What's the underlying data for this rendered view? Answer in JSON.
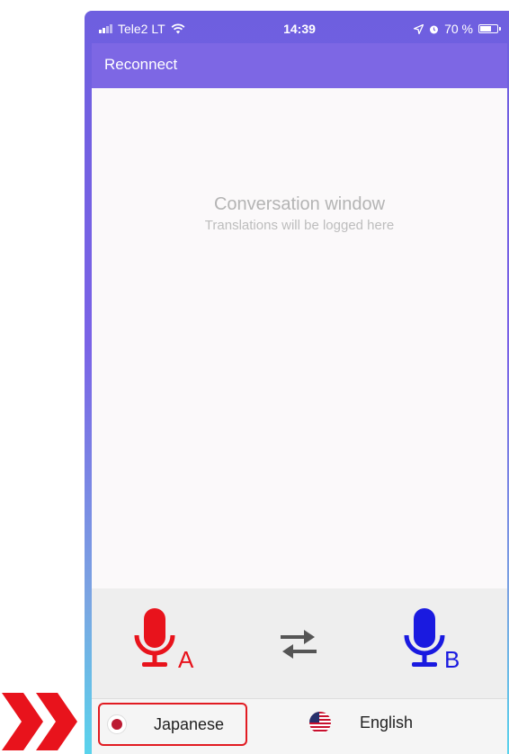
{
  "status_bar": {
    "carrier": "Tele2 LT",
    "time": "14:39",
    "battery_text": "70 %",
    "battery_level": 0.7
  },
  "header": {
    "reconnect_label": "Reconnect"
  },
  "conversation": {
    "title": "Conversation window",
    "subtitle": "Translations will be logged here"
  },
  "controls": {
    "mic_a": {
      "letter": "A",
      "color": "#e8131c",
      "icon": "microphone-icon"
    },
    "swap_icon": "swap-arrows-icon",
    "mic_b": {
      "letter": "B",
      "color": "#1a1ae0",
      "icon": "microphone-icon"
    }
  },
  "languages": {
    "a": {
      "label": "Japanese",
      "flag": "japan-flag-icon"
    },
    "b": {
      "label": "English",
      "flag": "us-flag-icon"
    }
  },
  "colors": {
    "header": "#7d67e4",
    "highlight": "#e11b22",
    "chevrons": "#e8131c"
  }
}
